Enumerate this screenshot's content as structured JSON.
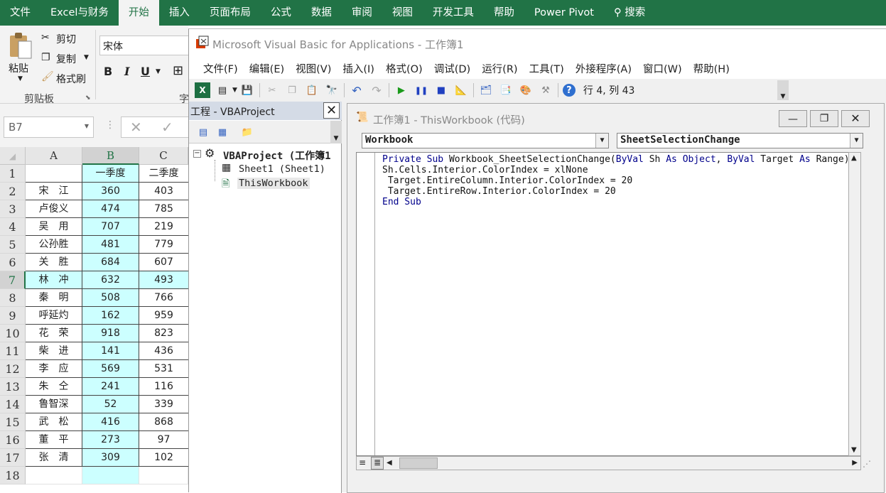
{
  "excel": {
    "tabs": [
      "文件",
      "Excel与财务",
      "开始",
      "插入",
      "页面布局",
      "公式",
      "数据",
      "审阅",
      "视图",
      "开发工具",
      "帮助",
      "Power Pivot",
      "搜索"
    ],
    "active_tab": "开始",
    "clipboard": {
      "paste": "粘贴",
      "cut": "剪切",
      "copy": "复制",
      "format_painter": "格式刷",
      "group": "剪贴板"
    },
    "font_name": "宋体",
    "font_buttons": [
      "B",
      "I",
      "U"
    ],
    "font_group_partial": "字",
    "name_box": "B7",
    "columns": [
      "A",
      "B",
      "C"
    ],
    "rows": [
      {
        "n": "1",
        "a": "",
        "b": "一季度",
        "c": "二季度"
      },
      {
        "n": "2",
        "a": "宋　江",
        "b": "360",
        "c": "403"
      },
      {
        "n": "3",
        "a": "卢俊义",
        "b": "474",
        "c": "785"
      },
      {
        "n": "4",
        "a": "吴　用",
        "b": "707",
        "c": "219"
      },
      {
        "n": "5",
        "a": "公孙胜",
        "b": "481",
        "c": "779"
      },
      {
        "n": "6",
        "a": "关　胜",
        "b": "684",
        "c": "607"
      },
      {
        "n": "7",
        "a": "林　冲",
        "b": "632",
        "c": "493"
      },
      {
        "n": "8",
        "a": "秦　明",
        "b": "508",
        "c": "766"
      },
      {
        "n": "9",
        "a": "呼延灼",
        "b": "162",
        "c": "959"
      },
      {
        "n": "10",
        "a": "花　荣",
        "b": "918",
        "c": "823"
      },
      {
        "n": "11",
        "a": "柴　进",
        "b": "141",
        "c": "436"
      },
      {
        "n": "12",
        "a": "李　应",
        "b": "569",
        "c": "531"
      },
      {
        "n": "13",
        "a": "朱　仝",
        "b": "241",
        "c": "116"
      },
      {
        "n": "14",
        "a": "鲁智深",
        "b": "52",
        "c": "339"
      },
      {
        "n": "15",
        "a": "武　松",
        "b": "416",
        "c": "868"
      },
      {
        "n": "16",
        "a": "董　平",
        "b": "273",
        "c": "97"
      },
      {
        "n": "17",
        "a": "张　清",
        "b": "309",
        "c": "102"
      },
      {
        "n": "18",
        "a": "",
        "b": "",
        "c": ""
      }
    ],
    "selected_row": "7",
    "selected_column": "B",
    "highlight_color": "#ccffff"
  },
  "vbe": {
    "title": "Microsoft Visual Basic for Applications - 工作簿1",
    "menu": [
      "文件(F)",
      "编辑(E)",
      "视图(V)",
      "插入(I)",
      "格式(O)",
      "调试(D)",
      "运行(R)",
      "工具(T)",
      "外接程序(A)",
      "窗口(W)",
      "帮助(H)"
    ],
    "position": "行 4, 列 43",
    "project_title": "工程 - VBAProject",
    "project_tree": {
      "root": "VBAProject (工作簿1",
      "items": [
        "Sheet1 (Sheet1)",
        "ThisWorkbook"
      ]
    },
    "code_window": {
      "title": "工作簿1 - ThisWorkbook (代码)",
      "object": "Workbook",
      "procedure": "SheetSelectionChange",
      "lines": [
        "Private Sub Workbook_SheetSelectionChange(ByVal Sh As Object, ByVal Target As Range)",
        "Sh.Cells.Interior.ColorIndex = xlNone",
        " Target.EntireColumn.Interior.ColorIndex = 20",
        " Target.EntireRow.Interior.ColorIndex = 20",
        "End Sub"
      ]
    }
  }
}
